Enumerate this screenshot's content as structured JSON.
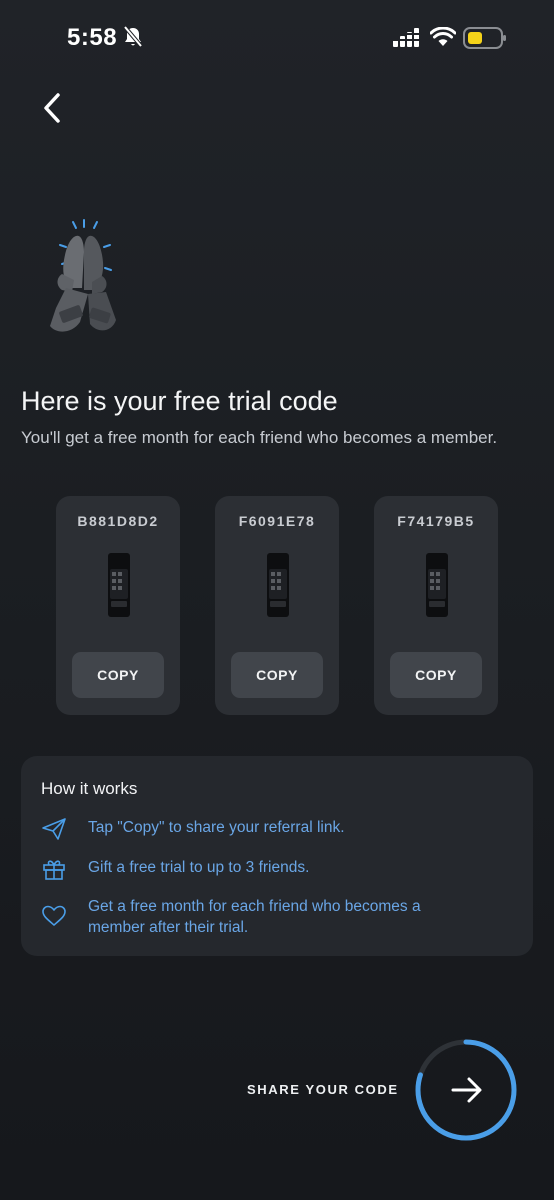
{
  "status_bar": {
    "time": "5:58"
  },
  "icons": {
    "back": "chevron-left-icon",
    "hero": "high-five-hands-icon",
    "send": "paper-plane-icon",
    "gift": "gift-icon",
    "heart": "heart-icon",
    "next": "arrow-right-icon"
  },
  "colors": {
    "accent": "#4a9ee8",
    "link_text": "#6aa6e6",
    "card": "#2c2f34",
    "button": "#41454b",
    "battery": "#f5d31a"
  },
  "header": {
    "title": "Here is your free trial code",
    "subtitle": "You'll get a free month for each friend who becomes a member."
  },
  "codes": [
    {
      "code": "B881D8D2",
      "button": "COPY"
    },
    {
      "code": "F6091E78",
      "button": "COPY"
    },
    {
      "code": "F74179B5",
      "button": "COPY"
    }
  ],
  "how_it_works": {
    "title": "How it works",
    "items": [
      {
        "text": "Tap \"Copy\" to share your referral link."
      },
      {
        "text": "Gift a free trial to up to 3 friends."
      },
      {
        "text": "Get a free month for each friend who becomes a member after their trial."
      }
    ]
  },
  "footer": {
    "label": "SHARE YOUR CODE",
    "progress": 0.8
  }
}
